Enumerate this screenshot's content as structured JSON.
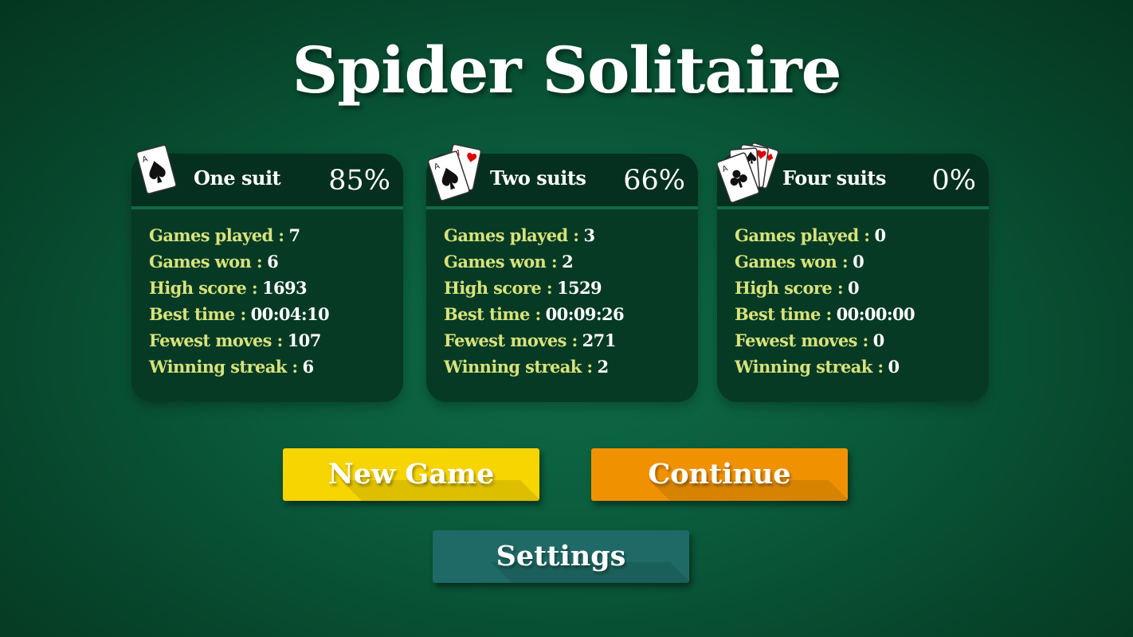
{
  "title": "Spider Solitaire",
  "panels": [
    {
      "name": "One suit",
      "percent": "85%",
      "icon": "ace-of-spades-card-icon",
      "stats": [
        {
          "label": "Games played :",
          "value": "7"
        },
        {
          "label": "Games won :",
          "value": "6"
        },
        {
          "label": "High score :",
          "value": "1693"
        },
        {
          "label": "Best time :",
          "value": "00:04:10"
        },
        {
          "label": "Fewest moves :",
          "value": "107"
        },
        {
          "label": "Winning streak :",
          "value": "6"
        }
      ]
    },
    {
      "name": "Two suits",
      "percent": "66%",
      "icon": "two-ace-cards-icon",
      "stats": [
        {
          "label": "Games played :",
          "value": "3"
        },
        {
          "label": "Games won :",
          "value": "2"
        },
        {
          "label": "High score :",
          "value": "1529"
        },
        {
          "label": "Best time :",
          "value": "00:09:26"
        },
        {
          "label": "Fewest moves :",
          "value": "271"
        },
        {
          "label": "Winning streak :",
          "value": "2"
        }
      ]
    },
    {
      "name": "Four suits",
      "percent": "0%",
      "icon": "four-ace-cards-icon",
      "stats": [
        {
          "label": "Games played :",
          "value": "0"
        },
        {
          "label": "Games won :",
          "value": "0"
        },
        {
          "label": "High score :",
          "value": "0"
        },
        {
          "label": "Best time :",
          "value": "00:00:00"
        },
        {
          "label": "Fewest moves :",
          "value": "0"
        },
        {
          "label": "Winning streak :",
          "value": "0"
        }
      ]
    }
  ],
  "buttons": {
    "new_game": "New Game",
    "continue": "Continue",
    "settings": "Settings"
  },
  "card_rank": "A",
  "colors": {
    "background": "#0a5a3b",
    "panel": "#063a25",
    "label": "#d7e27a",
    "new_game": "#f7d500",
    "continue": "#f09200",
    "settings": "#1f6a66"
  }
}
